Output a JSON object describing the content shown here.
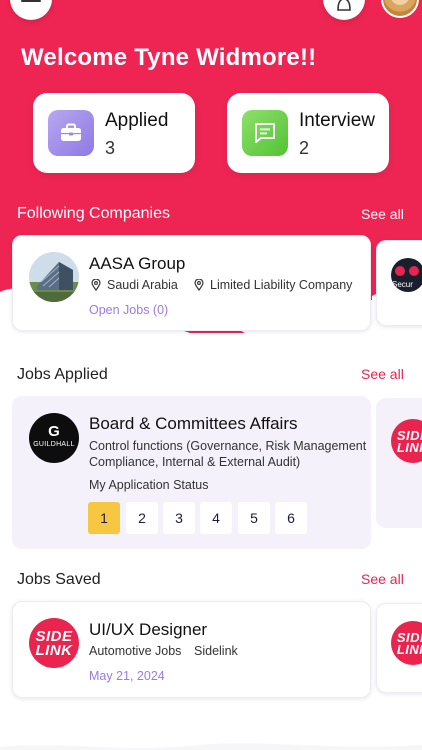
{
  "user": {
    "welcome": "Welcome Tyne Widmore!!"
  },
  "colors": {
    "brand": "#e8244f",
    "accent_purple": "#9b7be0",
    "status_active": "#f7c742"
  },
  "stats": [
    {
      "label": "Applied",
      "value": "3",
      "icon": "briefcase-icon"
    },
    {
      "label": "Interview",
      "value": "2",
      "icon": "chat-icon"
    }
  ],
  "following": {
    "title": "Following Companies",
    "see_all": "See all",
    "company": {
      "name": "AASA Group",
      "country": "Saudi Arabia",
      "type": "Limited Liability Company",
      "open_jobs": "Open Jobs (0)"
    },
    "next_logo_text": "Secur"
  },
  "applied": {
    "title": "Jobs Applied",
    "see_all": "See all",
    "job": {
      "title": "Board & Committees Affairs",
      "company_logo_text": "GUILDHALL",
      "desc_line1": "Control functions (Governance, Risk Management",
      "desc_line2": "Compliance, Internal & External Audit)",
      "status_label": "My Application Status",
      "steps": [
        "1",
        "2",
        "3",
        "4",
        "5",
        "6"
      ],
      "active_step": "1"
    },
    "next_logo_line1": "SIDE",
    "next_logo_line2": "LINK"
  },
  "saved": {
    "title": "Jobs Saved",
    "see_all": "See all",
    "job": {
      "title": "UI/UX Designer",
      "category": "Automotive Jobs",
      "company": "Sidelink",
      "date": "May 21, 2024",
      "logo_line1": "SIDE",
      "logo_line2": "LINK"
    },
    "next_logo_line1": "SIDE",
    "next_logo_line2": "LINK"
  }
}
